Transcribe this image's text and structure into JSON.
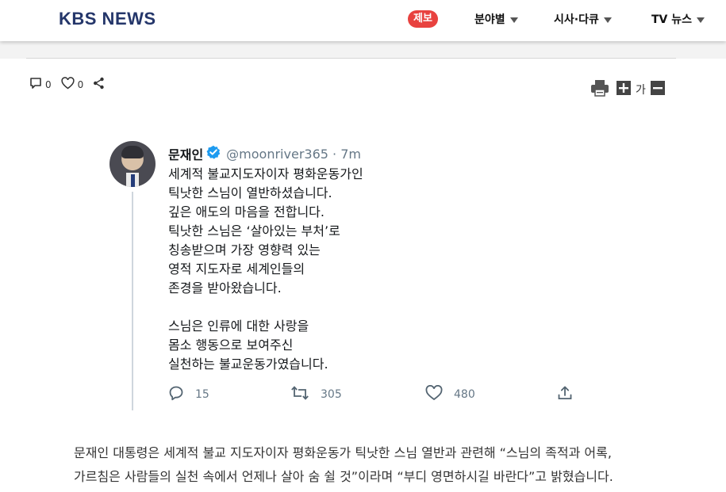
{
  "header": {
    "logo": "KBS NEWS",
    "tip_badge": "제보",
    "nav": [
      {
        "label": "분야별"
      },
      {
        "label": "시사·다큐"
      },
      {
        "label": "TV 뉴스"
      }
    ]
  },
  "toolbar": {
    "comment_count": "0",
    "like_count": "0",
    "font_size_label": "가",
    "icons": [
      "comment-icon",
      "heart-icon",
      "share-icon",
      "print-icon",
      "font-increase-icon",
      "font-decrease-icon"
    ]
  },
  "tweet": {
    "name": "문재인",
    "handle": "@moonriver365 · 7m",
    "paragraph1": [
      "세계적 불교지도자이자 평화운동가인",
      "틱낫한 스님이 열반하셨습니다.",
      "깊은 애도의 마음을 전합니다.",
      "틱낫한 스님은 ‘살아있는 부처’로",
      "칭송받으며 가장 영향력 있는",
      "영적 지도자로 세계인들의",
      "존경을 받아왔습니다."
    ],
    "paragraph2": [
      "스님은 인류에 대한 사랑을",
      "몸소 행동으로 보여주신",
      "실천하는 불교운동가였습니다."
    ],
    "replies": "15",
    "retweets": "305",
    "likes": "480",
    "verified_color": "#1d9bf0"
  },
  "article": {
    "lines": [
      "문재인 대통령은 세계적 불교 지도자이자 평화운동가 틱낫한 스님 열반과 관련해 “스님의 족적과 어록,",
      "가르침은 사람들의 실천 속에서 언제나 살아 숨 쉴 것”이라며 “부디 영면하시길 바란다”고 밝혔습니다."
    ]
  },
  "colors": {
    "brand": "#24366a",
    "tip_badge": "#e8423f"
  }
}
